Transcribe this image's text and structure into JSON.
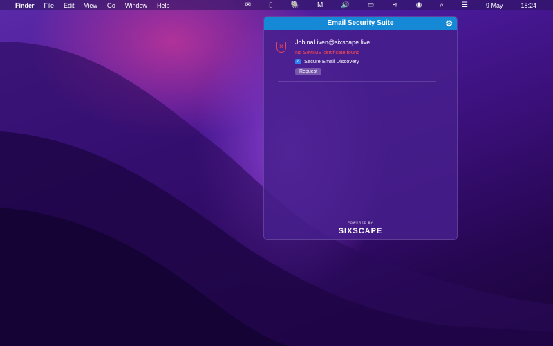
{
  "menubar": {
    "app": "Finder",
    "items": [
      "File",
      "Edit",
      "View",
      "Go",
      "Window",
      "Help"
    ],
    "date": "9 May",
    "time": "18:24"
  },
  "panel": {
    "title": "Email Security Suite",
    "email": "JobinaLiven@sixscape.live",
    "error": "No S/MIME certificate found",
    "checkbox_label": "Secure Email Discovery",
    "checkbox_checked": true,
    "request_label": "Request",
    "powered_by": "POWERED BY",
    "brand": "SIXSCAPE"
  }
}
